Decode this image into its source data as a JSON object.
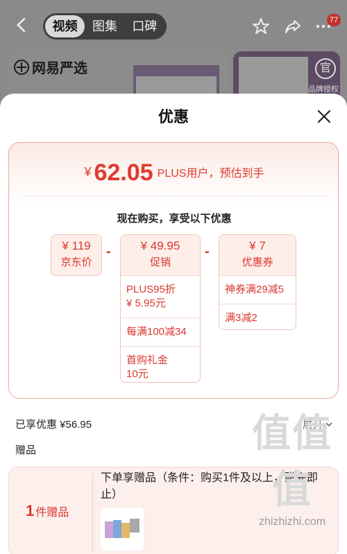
{
  "topbar": {
    "tabs": [
      {
        "label": "视频",
        "active": true
      },
      {
        "label": "图集",
        "active": false
      },
      {
        "label": "口碑",
        "active": false
      }
    ],
    "badge_count": "77"
  },
  "background": {
    "brand": "网易严选",
    "seal_char": "官",
    "seal_text": "品牌授权"
  },
  "sheet": {
    "title": "优惠",
    "final_price": {
      "currency": "¥",
      "amount": "62.05",
      "note": "PLUS用户，预估到手"
    },
    "subtitle": "现在购买，享受以下优惠",
    "breakdown": {
      "base": {
        "value": "¥ 119",
        "label": "京东价"
      },
      "promo": {
        "value": "¥ 49.95",
        "label": "促销",
        "items": [
          "PLUS95折\n¥ 5.95元",
          "每满100减34",
          "首购礼金\n10元"
        ]
      },
      "coupon": {
        "value": "¥ 7",
        "label": "优惠券",
        "items": [
          "神券满29减5",
          "满3减2"
        ]
      },
      "operators": [
        "-",
        "-"
      ]
    },
    "enjoyed": "已享优惠 ¥56.95",
    "expand_label": "展开",
    "gifts": {
      "title": "赠品",
      "count": "1",
      "count_unit": "件赠品",
      "condition": "下单享赠品（条件：购买1件及以上，赠完即止）"
    }
  },
  "watermark": {
    "text": "值值值",
    "domain": "zhizhizhi.com"
  },
  "colors": {
    "accent": "#e03a2e",
    "border": "#e9a89b"
  }
}
